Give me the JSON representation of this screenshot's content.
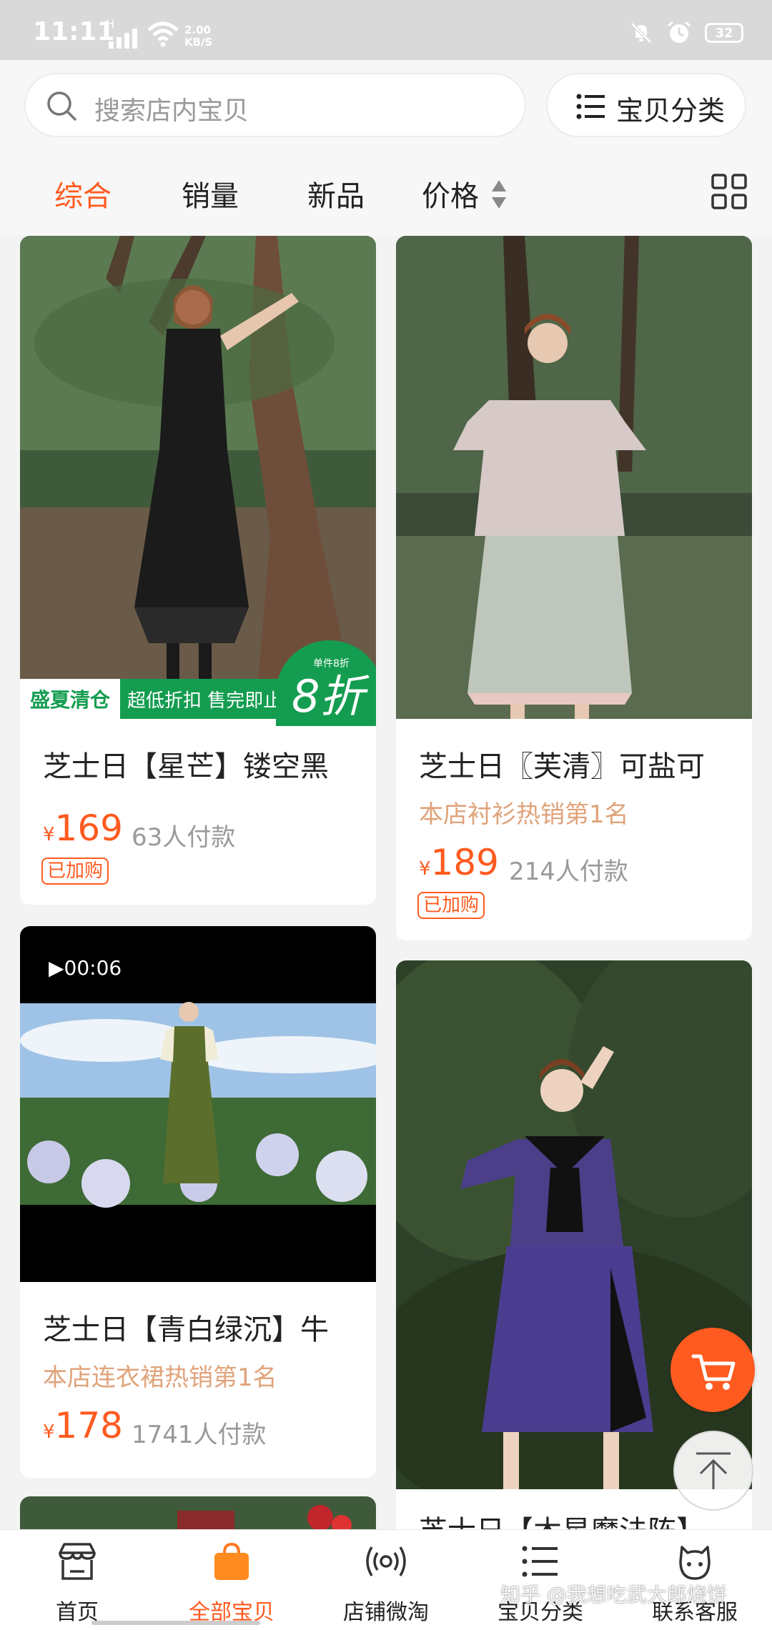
{
  "status_bar": {
    "time": "11:11",
    "network": "H",
    "speed_value": "2.00",
    "speed_unit": "KB/S",
    "battery": "32"
  },
  "search": {
    "placeholder": "搜索店内宝贝",
    "category_label": "宝贝分类"
  },
  "sort_tabs": [
    {
      "label": "综合",
      "active": true
    },
    {
      "label": "销量",
      "active": false
    },
    {
      "label": "新品",
      "active": false
    },
    {
      "label": "价格",
      "active": false
    }
  ],
  "products": [
    {
      "title": "芝士日【星芒】镂空黑",
      "price": "169",
      "sold": "63人付款",
      "tag": "已加购",
      "promo": {
        "left": "盛夏清仓",
        "middle": "超低折扣 售完即止",
        "badge_small": "单件8折",
        "badge_big": "8折"
      }
    },
    {
      "title": "芝士日〖芙清〗可盐可",
      "subtitle": "本店衬衫热销第1名",
      "price": "189",
      "sold": "214人付款",
      "tag": "已加购"
    },
    {
      "title": "芝士日【青白绿沉】牛",
      "subtitle": "本店连衣裙热销第1名",
      "price": "178",
      "sold": "1741人付款",
      "video_duration": "▶00:06"
    },
    {
      "title": "芝士日【木星魔法阵】"
    }
  ],
  "currency_symbol": "¥",
  "bottom_nav": [
    {
      "label": "首页",
      "icon": "shop-icon",
      "active": false
    },
    {
      "label": "全部宝贝",
      "icon": "bag-icon",
      "active": true
    },
    {
      "label": "店铺微淘",
      "icon": "broadcast-icon",
      "active": false
    },
    {
      "label": "宝贝分类",
      "icon": "list-icon",
      "active": false
    },
    {
      "label": "联系客服",
      "icon": "service-icon",
      "active": false
    }
  ],
  "watermark": "知乎 @我想吃武大郎烧饼",
  "colors": {
    "accent": "#ff5a1f",
    "promo_green": "#149d50",
    "subtitle": "#e0a37b"
  }
}
